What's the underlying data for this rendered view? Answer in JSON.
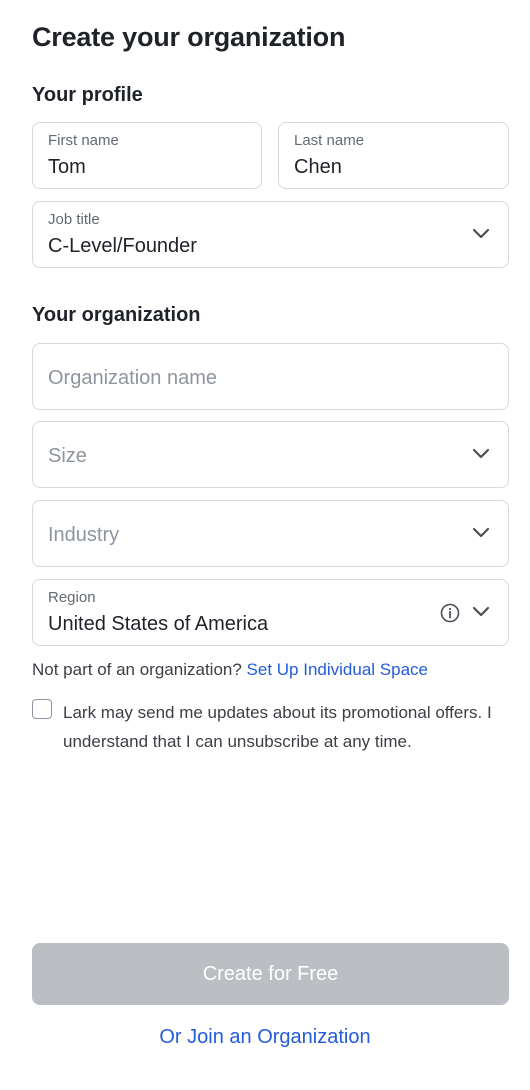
{
  "page": {
    "title": "Create your organization"
  },
  "profile": {
    "section_title": "Your profile",
    "first_name": {
      "label": "First name",
      "value": "Tom"
    },
    "last_name": {
      "label": "Last name",
      "value": "Chen"
    },
    "job_title": {
      "label": "Job title",
      "value": "C-Level/Founder"
    }
  },
  "organization": {
    "section_title": "Your organization",
    "org_name": {
      "placeholder": "Organization name"
    },
    "size": {
      "placeholder": "Size"
    },
    "industry": {
      "placeholder": "Industry"
    },
    "region": {
      "label": "Region",
      "value": "United States of America"
    }
  },
  "hint": {
    "text": "Not part of an organization? ",
    "link": "Set Up Individual Space"
  },
  "consent": {
    "checked": false,
    "text": "Lark may send me updates about its promotional offers. I understand that I can unsubscribe at any time."
  },
  "actions": {
    "primary": "Create for Free",
    "secondary": "Or Join an Organization"
  },
  "icons": {
    "dropdown": "chevron-down-icon",
    "info": "info-icon"
  },
  "colors": {
    "link": "#245bdb",
    "disabled_button": "#bbbfc4",
    "border": "#d5d8dc"
  }
}
